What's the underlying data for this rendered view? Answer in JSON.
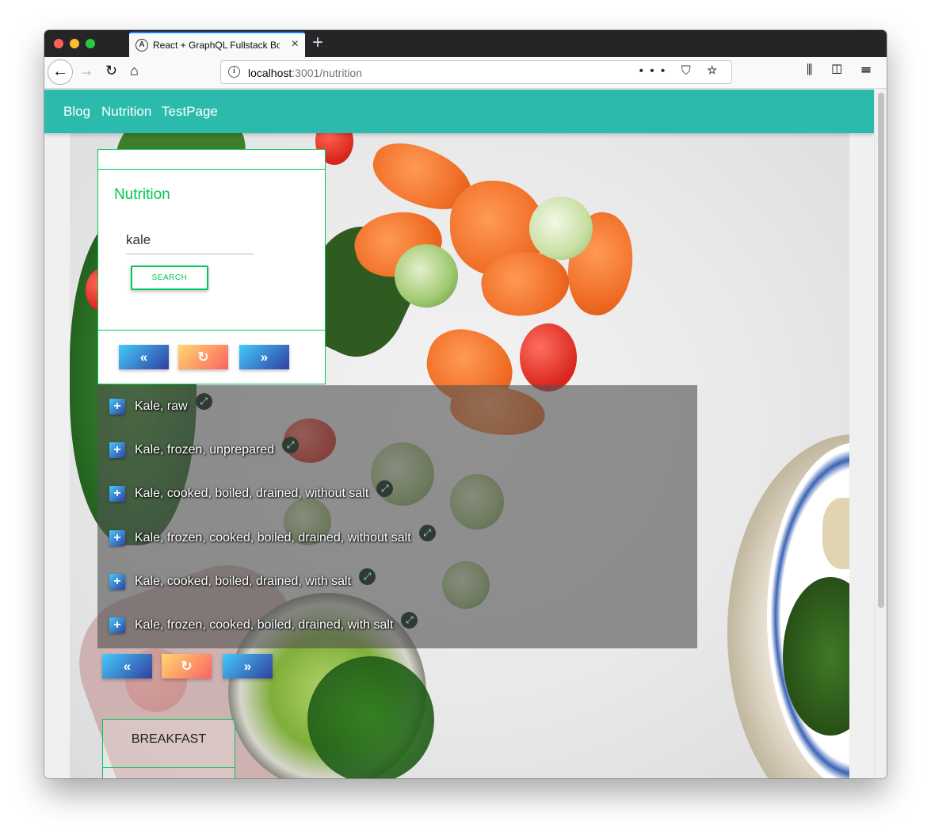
{
  "browser": {
    "tab_favicon": "A",
    "tab_title": "React + GraphQL Fullstack Boilerplate",
    "tab_close": "×",
    "new_tab": "+",
    "url_host": "localhost",
    "url_path": ":3001/nutrition",
    "url_info_icon": "i",
    "page_actions": "••• ⛉ ☆",
    "toolbar_right": "⫼ ◫ ☰"
  },
  "nav": {
    "links": [
      "Blog",
      "Nutrition",
      "TestPage"
    ]
  },
  "search_card": {
    "title": "Nutrition",
    "input_value": "kale",
    "search_button": "SEARCH"
  },
  "pager": {
    "prev": "«",
    "reset": "↻",
    "next": "»"
  },
  "results": [
    "Kale, raw",
    "Kale, frozen, unprepared",
    "Kale, cooked, boiled, drained, without salt",
    "Kale, frozen, cooked, boiled, drained, without salt",
    "Kale, cooked, boiled, drained, with salt",
    "Kale, frozen, cooked, boiled, drained, with salt"
  ],
  "result_icons": {
    "add": "+",
    "expand": "⤢"
  },
  "meal": {
    "label": "BREAKFAST"
  },
  "colors": {
    "navbar": "#2bbbad",
    "accent_green": "#00c853",
    "browser_tab_accent": "#0a84ff"
  }
}
